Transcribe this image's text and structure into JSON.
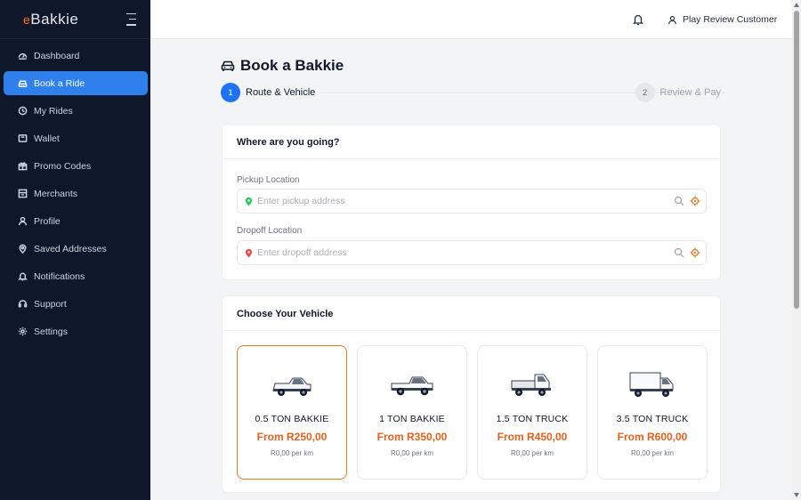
{
  "brand": {
    "prefix": "e",
    "name": "Bakkie"
  },
  "sidebar": {
    "items": [
      {
        "label": "Dashboard",
        "icon": "dashboard-icon"
      },
      {
        "label": "Book a Ride",
        "icon": "car-icon",
        "active": true
      },
      {
        "label": "My Rides",
        "icon": "history-icon"
      },
      {
        "label": "Wallet",
        "icon": "wallet-icon"
      },
      {
        "label": "Promo Codes",
        "icon": "gift-icon"
      },
      {
        "label": "Merchants",
        "icon": "store-icon"
      },
      {
        "label": "Profile",
        "icon": "user-icon"
      },
      {
        "label": "Saved Addresses",
        "icon": "map-pin-icon"
      },
      {
        "label": "Notifications",
        "icon": "bell-icon"
      },
      {
        "label": "Support",
        "icon": "headset-icon"
      },
      {
        "label": "Settings",
        "icon": "gear-icon"
      }
    ]
  },
  "header": {
    "user_name": "Play Review Customer"
  },
  "main": {
    "title": "Book a Bakkie",
    "steps": [
      {
        "number": "1",
        "label": "Route & Vehicle"
      },
      {
        "number": "2",
        "label": "Review & Pay"
      }
    ],
    "route": {
      "heading": "Where are you going?",
      "pickup_label": "Pickup Location",
      "pickup_placeholder": "Enter pickup address",
      "dropoff_label": "Dropoff Location",
      "dropoff_placeholder": "Enter dropoff address"
    },
    "vehicles": {
      "heading": "Choose Your Vehicle",
      "options": [
        {
          "name": "0.5 TON BAKKIE",
          "price": "From R250,00",
          "rate": "R0,00 per km",
          "selected": true
        },
        {
          "name": "1 TON BAKKIE",
          "price": "From R350,00",
          "rate": "R0,00 per km"
        },
        {
          "name": "1.5 TON TRUCK",
          "price": "From R450,00",
          "rate": "R0,00 per km"
        },
        {
          "name": "3.5 TON TRUCK",
          "price": "From R600,00",
          "rate": "R0,00 per km"
        }
      ]
    }
  },
  "colors": {
    "accent": "#2f80ed",
    "sidebar_bg": "#0f172a",
    "selected_border": "#e8782c",
    "price": "#e35f1c"
  }
}
